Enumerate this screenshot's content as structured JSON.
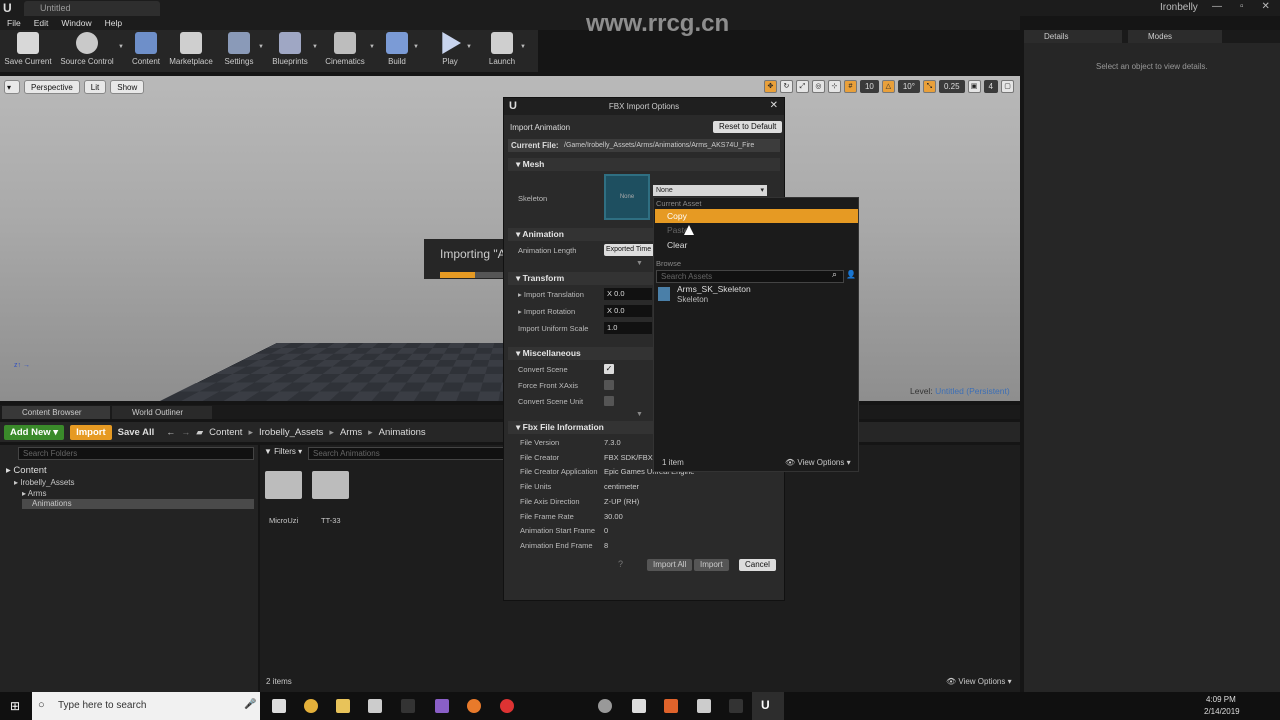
{
  "window": {
    "tab_title": "Untitled",
    "user": "Ironbelly"
  },
  "menu": [
    "File",
    "Edit",
    "Window",
    "Help"
  ],
  "toolbar": [
    {
      "label": "Save Current",
      "icon": "save-icon"
    },
    {
      "label": "Source Control",
      "icon": "source-control-icon"
    },
    {
      "label": "Content",
      "icon": "content-icon"
    },
    {
      "label": "Marketplace",
      "icon": "marketplace-icon"
    },
    {
      "label": "Settings",
      "icon": "settings-icon"
    },
    {
      "label": "Blueprints",
      "icon": "blueprints-icon"
    },
    {
      "label": "Cinematics",
      "icon": "cinematics-icon"
    },
    {
      "label": "Build",
      "icon": "build-icon"
    },
    {
      "label": "Play",
      "icon": "play-icon"
    },
    {
      "label": "Launch",
      "icon": "launch-icon"
    }
  ],
  "viewport": {
    "buttons": [
      "Perspective",
      "Lit",
      "Show"
    ],
    "grid_snap": "10",
    "rot_snap": "10°",
    "scale_snap": "0.25",
    "cam_speed": "4",
    "importing_text": "Importing \"A",
    "import_progress": 0.55,
    "level_label": "Level:",
    "level_name": "Untitled (Persistent)"
  },
  "watermark": "www.rrcg.cn",
  "details": {
    "tab_details": "Details",
    "tab_modes": "Modes",
    "empty": "Select an object to view details."
  },
  "content_browser": {
    "tab_cb": "Content Browser",
    "tab_outliner": "World Outliner",
    "add_new": "Add New",
    "import": "Import",
    "save_all": "Save All",
    "path": [
      "Content",
      "Irobelly_Assets",
      "Arms",
      "Animations"
    ],
    "search_folders": "Search Folders",
    "filters": "Filters",
    "search_animations": "Search Animations",
    "tree": [
      "Content",
      "Irobelly_Assets",
      "Arms",
      "Animations"
    ],
    "folders": [
      "MicroUzi",
      "TT-33"
    ],
    "item_count": "2 items",
    "view_options": "View Options"
  },
  "dialog": {
    "title": "FBX Import Options",
    "import_type": "Import Animation",
    "reset": "Reset to Default",
    "current_file_label": "Current File:",
    "current_file": "/Game/Irobelly_Assets/Arms/Animations/Arms_AKS74U_Fire",
    "sections": {
      "mesh": "Mesh",
      "animation": "Animation",
      "transform": "Transform",
      "misc": "Miscellaneous",
      "fbx": "Fbx File Information"
    },
    "skeleton_label": "Skeleton",
    "skeleton_thumb": "None",
    "skeleton_value": "None",
    "anim_length_label": "Animation Length",
    "anim_length_value": "Exported Time",
    "import_translation": "Import Translation",
    "import_rotation": "Import Rotation",
    "import_uniform_scale": "Import Uniform Scale",
    "translation_val": "X  0.0",
    "rotation_val": "X  0.0",
    "scale_val": "1.0",
    "convert_scene": "Convert Scene",
    "force_front": "Force Front XAxis",
    "convert_unit": "Convert Scene Unit",
    "convert_scene_checked": true,
    "fbx_info": [
      [
        "File Version",
        "7.3.0"
      ],
      [
        "File Creator",
        "FBX SDK/FBX"
      ],
      [
        "File Creator Application",
        "Epic Games Unreal Engine"
      ],
      [
        "File Units",
        "centimeter"
      ],
      [
        "File Axis Direction",
        "Z-UP (RH)"
      ],
      [
        "File Frame Rate",
        "30.00"
      ],
      [
        "Animation Start Frame",
        "0"
      ],
      [
        "Animation End Frame",
        "8"
      ]
    ],
    "import_all": "Import All",
    "import": "Import",
    "cancel": "Cancel"
  },
  "dropdown": {
    "current_asset": "Current Asset",
    "copy": "Copy",
    "paste": "Paste",
    "clear": "Clear",
    "browse": "Browse",
    "search_placeholder": "Search Assets",
    "asset_name": "Arms_SK_Skeleton",
    "asset_type": "Skeleton",
    "item_count": "1 item",
    "view_options": "View Options"
  },
  "taskbar": {
    "search": "Type here to search",
    "time": "4:09 PM",
    "date": "2/14/2019"
  }
}
